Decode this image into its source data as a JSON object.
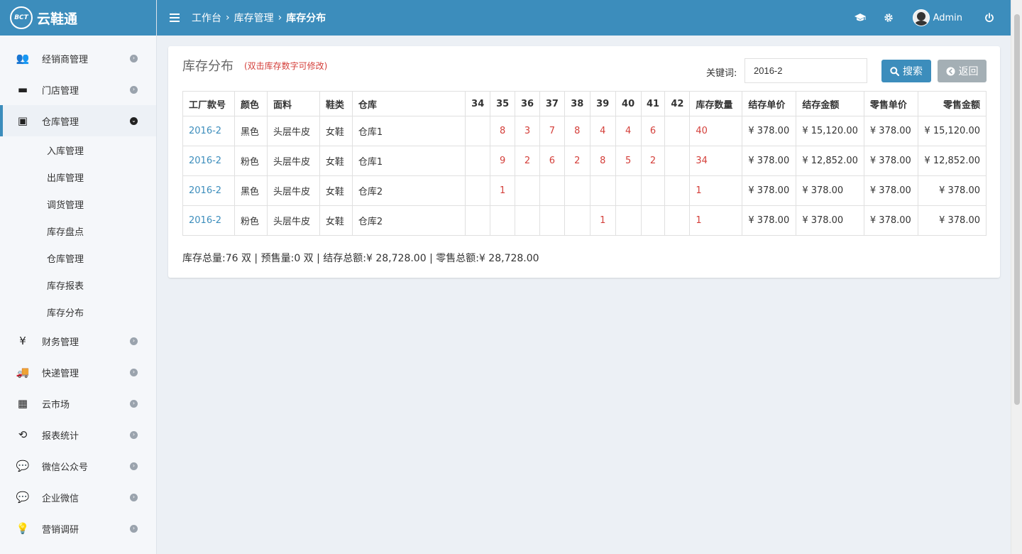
{
  "app": {
    "logo_mark": "BCT",
    "name": "云鞋通"
  },
  "sidebar": {
    "items": [
      {
        "label": "经销商管理",
        "icon": "users-icon",
        "glyph": "👥"
      },
      {
        "label": "门店管理",
        "icon": "archive-icon",
        "glyph": "▬"
      },
      {
        "label": "仓库管理",
        "icon": "box-icon",
        "glyph": "▣",
        "expanded": true,
        "children": [
          "入库管理",
          "出库管理",
          "调货管理",
          "库存盘点",
          "仓库管理",
          "库存报表",
          "库存分布"
        ]
      },
      {
        "label": "财务管理",
        "icon": "yen-icon",
        "glyph": "¥"
      },
      {
        "label": "快递管理",
        "icon": "truck-icon",
        "glyph": "🚚"
      },
      {
        "label": "云市场",
        "icon": "building-icon",
        "glyph": "▦"
      },
      {
        "label": "报表统计",
        "icon": "history-icon",
        "glyph": "⟲"
      },
      {
        "label": "微信公众号",
        "icon": "wechat-icon",
        "glyph": "💬"
      },
      {
        "label": "企业微信",
        "icon": "wechat-work-icon",
        "glyph": "💬"
      },
      {
        "label": "营销调研",
        "icon": "lightbulb-icon",
        "glyph": "💡"
      }
    ]
  },
  "topbar": {
    "breadcrumb": [
      "工作台",
      "库存管理",
      "库存分布"
    ],
    "separator": "›",
    "user_name": "Admin"
  },
  "panel": {
    "title": "库存分布",
    "hint": "(双击库存数字可修改)",
    "keyword_label": "关键词:",
    "keyword_value": "2016-2",
    "search_label": "搜索",
    "back_label": "返回"
  },
  "table": {
    "headers": [
      "工厂款号",
      "颜色",
      "面料",
      "鞋类",
      "仓库",
      "34",
      "35",
      "36",
      "37",
      "38",
      "39",
      "40",
      "41",
      "42",
      "库存数量",
      "结存单价",
      "结存金额",
      "零售单价",
      "零售金额"
    ],
    "rows": [
      {
        "code": "2016-2",
        "color": "黑色",
        "material": "头层牛皮",
        "type": "女鞋",
        "warehouse": "仓库1",
        "sizes": [
          "",
          "8",
          "3",
          "7",
          "8",
          "4",
          "4",
          "6",
          ""
        ],
        "qty": "40",
        "unit_cost": "¥ 378.00",
        "cost_amount": "¥ 15,120.00",
        "retail_price": "¥ 378.00",
        "retail_amount": "¥ 15,120.00"
      },
      {
        "code": "2016-2",
        "color": "粉色",
        "material": "头层牛皮",
        "type": "女鞋",
        "warehouse": "仓库1",
        "sizes": [
          "",
          "9",
          "2",
          "6",
          "2",
          "8",
          "5",
          "2",
          ""
        ],
        "qty": "34",
        "unit_cost": "¥ 378.00",
        "cost_amount": "¥ 12,852.00",
        "retail_price": "¥ 378.00",
        "retail_amount": "¥ 12,852.00"
      },
      {
        "code": "2016-2",
        "color": "黑色",
        "material": "头层牛皮",
        "type": "女鞋",
        "warehouse": "仓库2",
        "sizes": [
          "",
          "1",
          "",
          "",
          "",
          "",
          "",
          "",
          ""
        ],
        "qty": "1",
        "unit_cost": "¥ 378.00",
        "cost_amount": "¥ 378.00",
        "retail_price": "¥ 378.00",
        "retail_amount": "¥ 378.00"
      },
      {
        "code": "2016-2",
        "color": "粉色",
        "material": "头层牛皮",
        "type": "女鞋",
        "warehouse": "仓库2",
        "sizes": [
          "",
          "",
          "",
          "",
          "",
          "1",
          "",
          "",
          ""
        ],
        "qty": "1",
        "unit_cost": "¥ 378.00",
        "cost_amount": "¥ 378.00",
        "retail_price": "¥ 378.00",
        "retail_amount": "¥ 378.00"
      }
    ]
  },
  "summary": "库存总量:76 双 | 预售量:0 双 | 结存总额:¥ 28,728.00 | 零售总额:¥ 28,728.00",
  "colors": {
    "primary": "#3c8dbc",
    "danger": "#d43f3a",
    "muted_button": "#a4afb5"
  }
}
